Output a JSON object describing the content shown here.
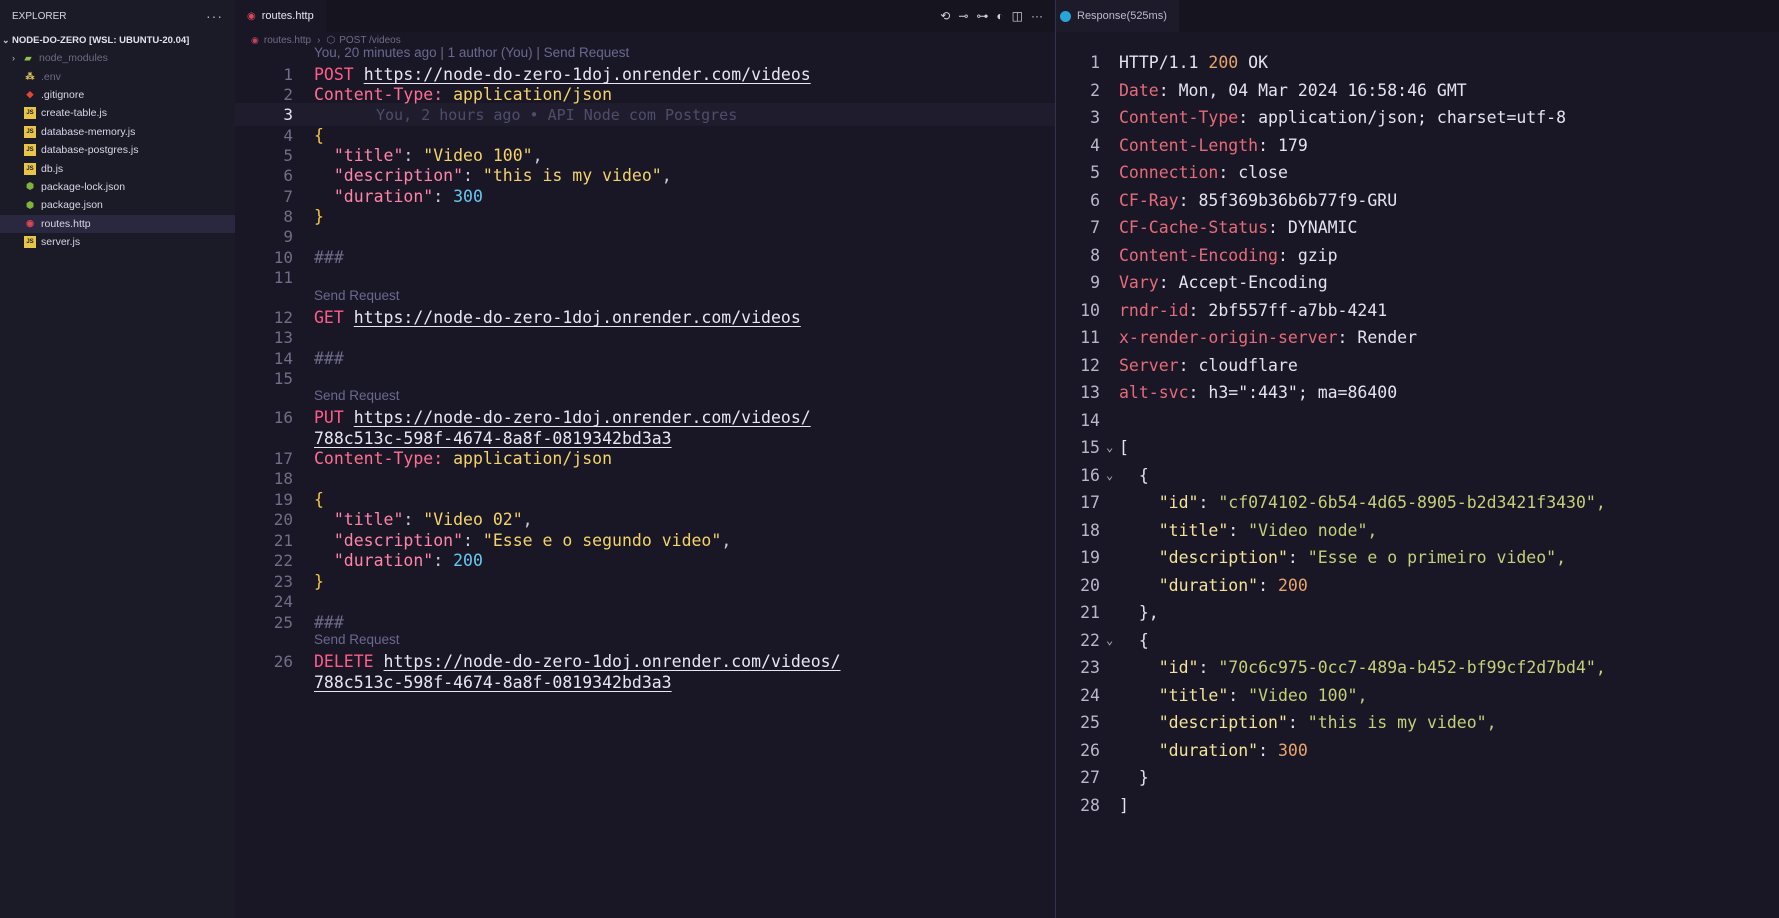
{
  "explorer": {
    "title": "EXPLORER",
    "more": "···",
    "workspace": "NODE-DO-ZERO [WSL: UBUNTU-20.04]",
    "files": [
      {
        "name": "node_modules",
        "kind": "folder",
        "icon": "folder-icon"
      },
      {
        "name": ".env",
        "kind": "dim",
        "icon": "env-icon"
      },
      {
        "name": ".gitignore",
        "kind": "file",
        "icon": "git-icon"
      },
      {
        "name": "create-table.js",
        "kind": "file",
        "icon": "js-icon"
      },
      {
        "name": "database-memory.js",
        "kind": "file",
        "icon": "js-icon"
      },
      {
        "name": "database-postgres.js",
        "kind": "file",
        "icon": "js-icon"
      },
      {
        "name": "db.js",
        "kind": "file",
        "icon": "js-icon"
      },
      {
        "name": "package-lock.json",
        "kind": "file",
        "icon": "node-icon"
      },
      {
        "name": "package.json",
        "kind": "file",
        "icon": "node-icon"
      },
      {
        "name": "routes.http",
        "kind": "active",
        "icon": "http-icon"
      },
      {
        "name": "server.js",
        "kind": "file",
        "icon": "js-icon"
      }
    ]
  },
  "editor": {
    "tab": "routes.http",
    "breadcrumb": {
      "file": "routes.http",
      "symbol": "POST /videos"
    },
    "blame_lens": "You, 20 minutes ago | 1 author (You) | Send Request",
    "send_request": "Send Request",
    "ghost_blame": "You, 2 hours ago • API Node com Postgres",
    "lines": [
      {
        "n": "1",
        "method": "POST",
        "url": "https://node-do-zero-1doj.onrender.com/videos"
      },
      {
        "n": "2",
        "header": "Content-Type:",
        "value": "application/json"
      },
      {
        "n": "3"
      },
      {
        "n": "4",
        "brace": "{"
      },
      {
        "n": "5",
        "key": "\"title\"",
        "str": "\"Video 100\""
      },
      {
        "n": "6",
        "key": "\"description\"",
        "str": "\"this is my video\""
      },
      {
        "n": "7",
        "key": "\"duration\"",
        "num": "300"
      },
      {
        "n": "8",
        "brace": "}"
      },
      {
        "n": "9"
      },
      {
        "n": "10",
        "comment": "###"
      },
      {
        "n": "11"
      },
      {
        "n": "12",
        "method": "GET",
        "url": "https://node-do-zero-1doj.onrender.com/videos"
      },
      {
        "n": "13"
      },
      {
        "n": "14",
        "comment": "###"
      },
      {
        "n": "15"
      },
      {
        "n": "16",
        "method": "PUT",
        "url": "https://node-do-zero-1doj.onrender.com/videos/",
        "url2": "788c513c-598f-4674-8a8f-0819342bd3a3"
      },
      {
        "n": "17",
        "header": "Content-Type:",
        "value": "application/json"
      },
      {
        "n": "18"
      },
      {
        "n": "19",
        "brace": "{"
      },
      {
        "n": "20",
        "key": "\"title\"",
        "str": "\"Video 02\""
      },
      {
        "n": "21",
        "key": "\"description\"",
        "str": "\"Esse e o segundo video\""
      },
      {
        "n": "22",
        "key": "\"duration\"",
        "num": "200"
      },
      {
        "n": "23",
        "brace": "}"
      },
      {
        "n": "24"
      },
      {
        "n": "25",
        "comment": "###"
      },
      {
        "n": "26",
        "method": "DELETE",
        "url": "https://node-do-zero-1doj.onrender.com/videos/",
        "url2": "788c513c-598f-4674-8a8f-0819342bd3a3"
      }
    ]
  },
  "response": {
    "tab": "Response(525ms)",
    "lines": [
      [
        "1",
        "HTTP/1.1 ",
        "200",
        " OK"
      ],
      [
        "2",
        "Date",
        "Mon, 04 Mar 2024 16:58:46 GMT"
      ],
      [
        "3",
        "Content-Type",
        "application/json; charset=utf-8"
      ],
      [
        "4",
        "Content-Length",
        "179"
      ],
      [
        "5",
        "Connection",
        "close"
      ],
      [
        "6",
        "CF-Ray",
        "85f369b36b6b77f9-GRU"
      ],
      [
        "7",
        "CF-Cache-Status",
        "DYNAMIC"
      ],
      [
        "8",
        "Content-Encoding",
        "gzip"
      ],
      [
        "9",
        "Vary",
        "Accept-Encoding"
      ],
      [
        "10",
        "rndr-id",
        "2bf557ff-a7bb-4241"
      ],
      [
        "11",
        "x-render-origin-server",
        "Render"
      ],
      [
        "12",
        "Server",
        "cloudflare"
      ],
      [
        "13",
        "alt-svc",
        "h3=\":443\"; ma=86400"
      ]
    ],
    "body": [
      {
        "n": "14"
      },
      {
        "n": "15",
        "text": "[",
        "fold": true
      },
      {
        "n": "16",
        "text": "  {",
        "fold": true
      },
      {
        "n": "17",
        "key": "\"id\"",
        "str": "\"cf074102-6b54-4d65-8905-b2d3421f3430\","
      },
      {
        "n": "18",
        "key": "\"title\"",
        "str": "\"Video node\","
      },
      {
        "n": "19",
        "key": "\"description\"",
        "str": "\"Esse e o primeiro video\","
      },
      {
        "n": "20",
        "key": "\"duration\"",
        "num": "200"
      },
      {
        "n": "21",
        "text": "  },"
      },
      {
        "n": "22",
        "text": "  {",
        "fold": true
      },
      {
        "n": "23",
        "key": "\"id\"",
        "str": "\"70c6c975-0cc7-489a-b452-bf99cf2d7bd4\","
      },
      {
        "n": "24",
        "key": "\"title\"",
        "str": "\"Video 100\","
      },
      {
        "n": "25",
        "key": "\"description\"",
        "str": "\"this is my video\","
      },
      {
        "n": "26",
        "key": "\"duration\"",
        "num": "300"
      },
      {
        "n": "27",
        "text": "  }"
      },
      {
        "n": "28",
        "text": "]"
      }
    ]
  }
}
